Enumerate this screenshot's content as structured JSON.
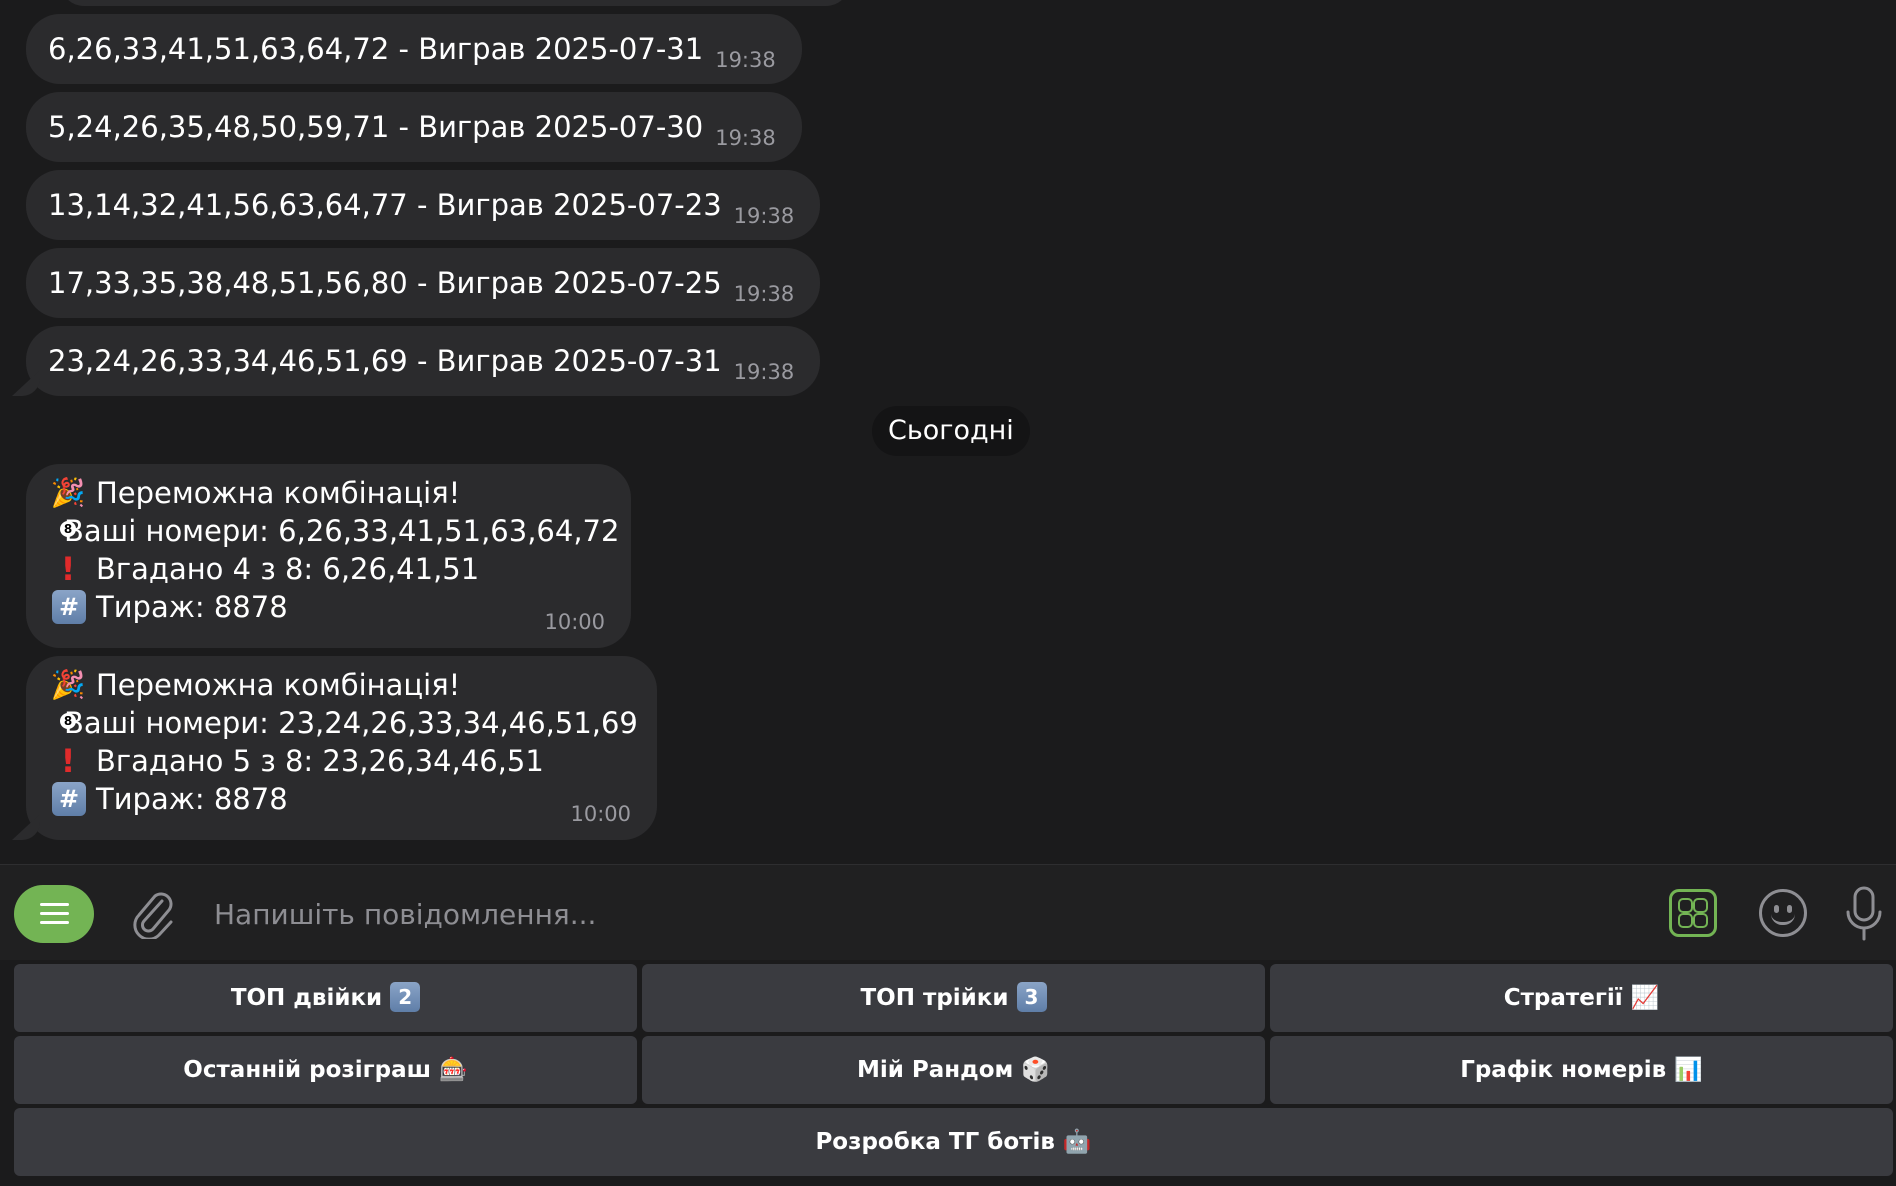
{
  "history_messages": [
    {
      "text": "6,26,33,41,51,63,64,72 - Виграв 2025-07-31",
      "time": "19:38"
    },
    {
      "text": "5,24,26,35,48,50,59,71 - Виграв 2025-07-30",
      "time": "19:38"
    },
    {
      "text": "13,14,32,41,56,63,64,77 - Виграв 2025-07-23",
      "time": "19:38"
    },
    {
      "text": "17,33,35,38,48,51,56,80 - Виграв 2025-07-25",
      "time": "19:38"
    },
    {
      "text": "23,24,26,33,34,46,51,69 - Виграв 2025-07-31",
      "time": "19:38"
    }
  ],
  "date_separator": "Сьогодні",
  "win_messages": [
    {
      "title": "Переможна комбінація!",
      "numbers": "Ваші номери: 6,26,33,41,51,63,64,72",
      "guessed": "Вгадано 4 з 8: 6,26,41,51",
      "draw": "Тираж: 8878",
      "time": "10:00"
    },
    {
      "title": "Переможна комбінація!",
      "numbers": "Ваші номери: 23,24,26,33,34,46,51,69",
      "guessed": "Вгадано 5 з 8: 23,26,34,46,51",
      "draw": "Тираж: 8878",
      "time": "10:00"
    }
  ],
  "composer": {
    "placeholder": "Напишіть повідомлення...",
    "icons": [
      "menu-icon",
      "attach-icon",
      "bot-keyboard-icon",
      "emoji-icon",
      "microphone-icon"
    ]
  },
  "keyboard": {
    "row1": [
      {
        "label": "ТОП двійки",
        "emoji": "2"
      },
      {
        "label": "ТОП трійки",
        "emoji": "3"
      },
      {
        "label": "Стратегії",
        "emoji": "📈"
      }
    ],
    "row2": [
      {
        "label": "Останній розіграш",
        "emoji": "🎰"
      },
      {
        "label": "Мій Рандом",
        "emoji": "🎲"
      },
      {
        "label": "Графік номерів",
        "emoji": "📊"
      }
    ],
    "row3": [
      {
        "label": "Розробка ТГ ботів",
        "emoji": "🤖"
      }
    ]
  },
  "colors": {
    "background": "#1b1b1c",
    "bubble": "#2b2b2d",
    "accent_green": "#73b454",
    "keyboard_button": "#3a3b40",
    "time_text": "#9a9aa0"
  }
}
